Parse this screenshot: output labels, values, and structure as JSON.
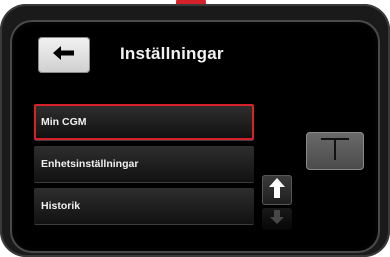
{
  "header": {
    "title": "Inställningar",
    "back_icon": "arrow-left-icon"
  },
  "menu": {
    "items": [
      {
        "label": "Min CGM",
        "selected": true
      },
      {
        "label": "Enhetsinställningar",
        "selected": false
      },
      {
        "label": "Historik",
        "selected": false
      }
    ]
  },
  "controls": {
    "scroll_up_icon": "arrow-up-icon",
    "scroll_down_icon": "arrow-down-icon",
    "t_button_icon": "t-shape-icon"
  },
  "colors": {
    "selection_border": "#d6202a",
    "indicator": "#d6202a"
  }
}
